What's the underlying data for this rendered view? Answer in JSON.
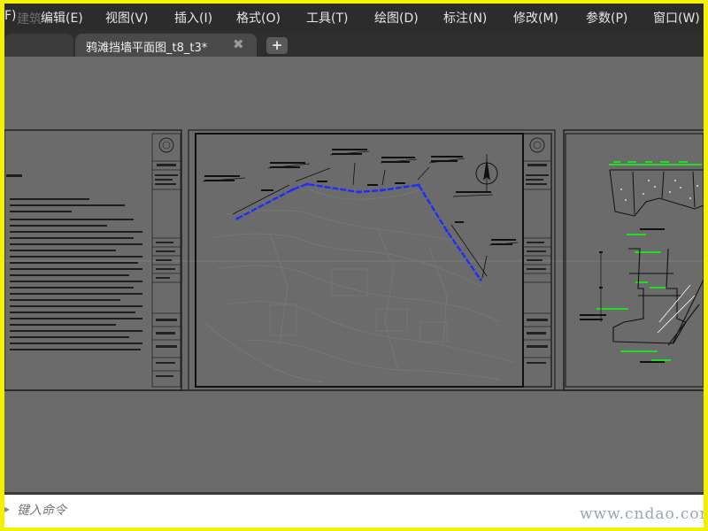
{
  "menubar": {
    "items": [
      "F)",
      "编辑(E)",
      "视图(V)",
      "插入(I)",
      "格式(O)",
      "工具(T)",
      "绘图(D)",
      "标注(N)",
      "修改(M)",
      "参数(P)",
      "窗口(W)"
    ],
    "logo_text": "建筑"
  },
  "tabs": {
    "active_label": "鸦滩挡墙平面图_t8_t3*",
    "close_glyph": "✖",
    "new_glyph": "+"
  },
  "command": {
    "prompt_glyph": "▸",
    "placeholder": "键入命令"
  },
  "watermark": "www.cndao.com",
  "colors": {
    "canvas": "#6b6b6b",
    "sheet_line": "#111111",
    "wall_line": "#1f2cff",
    "annotation_green": "#22dd22"
  }
}
